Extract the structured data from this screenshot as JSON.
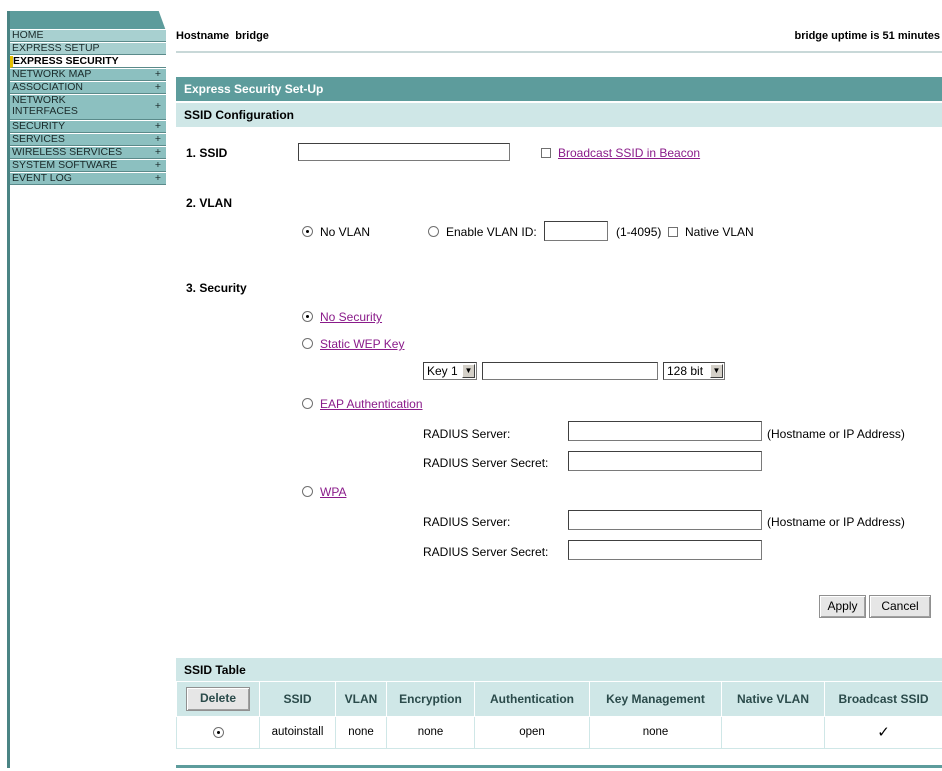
{
  "sidebar": {
    "items": [
      {
        "label": "HOME",
        "plus": ""
      },
      {
        "label": "EXPRESS SETUP",
        "plus": ""
      },
      {
        "label": "EXPRESS SECURITY",
        "plus": ""
      },
      {
        "label": "NETWORK MAP",
        "plus": "+"
      },
      {
        "label": "ASSOCIATION",
        "plus": "+"
      },
      {
        "label": "NETWORK INTERFACES",
        "plus": "+"
      },
      {
        "label": "SECURITY",
        "plus": "+"
      },
      {
        "label": "SERVICES",
        "plus": "+"
      },
      {
        "label": "WIRELESS SERVICES",
        "plus": "+"
      },
      {
        "label": "SYSTEM SOFTWARE",
        "plus": "+"
      },
      {
        "label": "EVENT LOG",
        "plus": "+"
      }
    ]
  },
  "header": {
    "hostname": "Hostname  bridge",
    "uptime": "bridge uptime is 51 minutes"
  },
  "panel": {
    "title": "Express Security Set-Up",
    "section": "SSID Configuration"
  },
  "ssid": {
    "label": "1. SSID",
    "value": "",
    "broadcast_label": "Broadcast SSID in Beacon",
    "broadcast_checked": false
  },
  "vlan": {
    "label": "2. VLAN",
    "no_vlan": "No VLAN",
    "enable_vlan": "Enable VLAN ID:",
    "vlan_id": "",
    "range": "(1-4095)",
    "native_vlan": "Native VLAN",
    "selected": "No VLAN"
  },
  "security": {
    "label": "3. Security",
    "no_security": "No Security",
    "static_wep": "Static WEP Key",
    "key_select": "Key 1",
    "key_value": "",
    "bit_select": "128 bit",
    "eap": "EAP Authentication",
    "radius_server": "RADIUS Server:",
    "radius_secret": "RADIUS Server Secret:",
    "hint": "(Hostname or IP Address)",
    "wpa": "WPA",
    "wpa_radius_server": "RADIUS Server:",
    "wpa_radius_secret": "RADIUS Server Secret:",
    "wpa_hint": "(Hostname or IP Address)",
    "selected": "No Security"
  },
  "buttons": {
    "apply": "Apply",
    "cancel": "Cancel",
    "delete": "Delete"
  },
  "ssid_table": {
    "title": "SSID Table",
    "columns": [
      "SSID",
      "VLAN",
      "Encryption",
      "Authentication",
      "Key Management",
      "Native VLAN",
      "Broadcast SSID"
    ],
    "rows": [
      {
        "ssid": "autoinstall",
        "vlan": "none",
        "encryption": "none",
        "authentication": "open",
        "key_management": "none",
        "native_vlan": "",
        "broadcast": "✓",
        "selected": true
      }
    ]
  },
  "colors": {
    "band": "#5d9c9c",
    "subband": "#cfe7e7",
    "link": "#8a1b8a",
    "nav": "#8cc0c0"
  }
}
